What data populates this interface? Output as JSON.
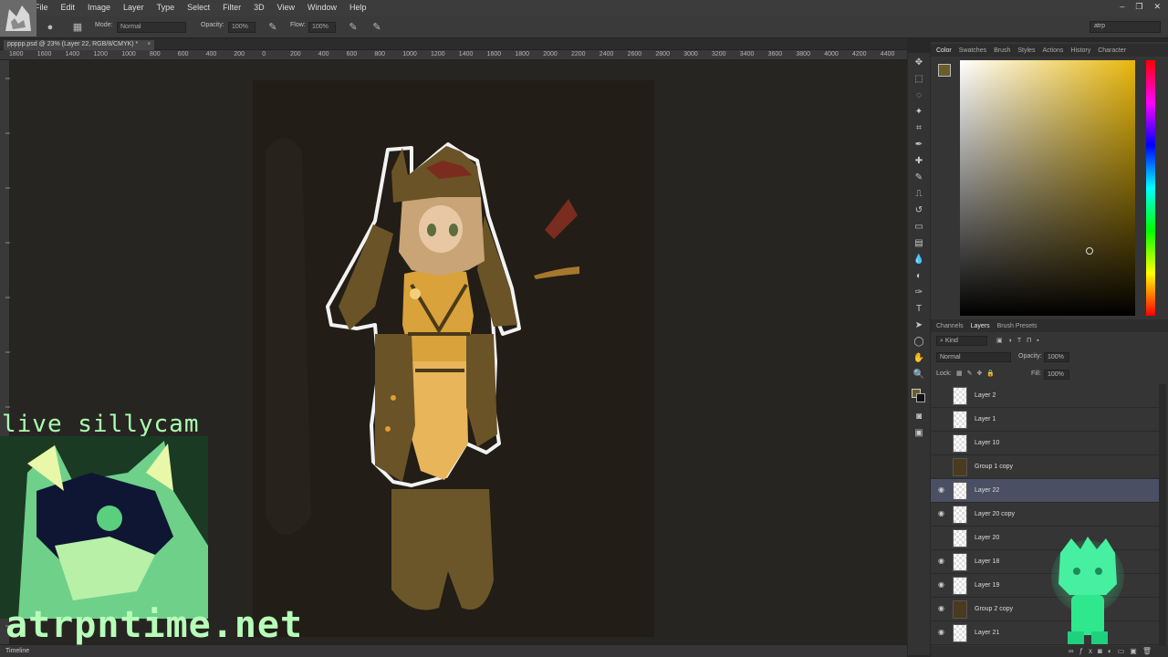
{
  "menubar": {
    "items": [
      "File",
      "Edit",
      "Image",
      "Layer",
      "Type",
      "Select",
      "Filter",
      "3D",
      "View",
      "Window",
      "Help"
    ],
    "window_controls": [
      "–",
      "❐",
      "✕"
    ]
  },
  "options": {
    "mode_label": "Mode:",
    "mode_value": "Normal",
    "opacity_label": "Opacity:",
    "opacity_value": "100%",
    "flow_label": "Flow:",
    "flow_value": "100%",
    "workspace": "atrp"
  },
  "document": {
    "tab_label": "ppppp.psd @ 23% (Layer 22, RGB/8/CMYK) *",
    "close": "×"
  },
  "ruler": {
    "ticks": [
      "1800",
      "1600",
      "1400",
      "1200",
      "1000",
      "800",
      "600",
      "400",
      "200",
      "0",
      "200",
      "400",
      "600",
      "800",
      "1000",
      "1200",
      "1400",
      "1600",
      "1800",
      "2000",
      "2200",
      "2400",
      "2600",
      "2800",
      "3000",
      "3200",
      "3400",
      "3600",
      "3800",
      "4000",
      "4200",
      "4400"
    ]
  },
  "status": {
    "timeline": "Timeline"
  },
  "color_panel": {
    "tabs": [
      "Color",
      "Swatches",
      "Brush",
      "Styles",
      "Actions",
      "History",
      "Character"
    ],
    "active_tab": "Color",
    "foreground": "#6b5c2b",
    "hue": "#e8b70c"
  },
  "layers_panel": {
    "tabs": [
      "Channels",
      "Layers",
      "Brush Presets"
    ],
    "active_tab": "Layers",
    "filter_kind": "Kind",
    "blend_mode": "Normal",
    "opacity_label": "Opacity:",
    "opacity_value": "100%",
    "lock_label": "Lock:",
    "fill_label": "Fill:",
    "fill_value": "100%",
    "layers": [
      {
        "name": "Layer 2",
        "visible": false,
        "selected": false,
        "group": false
      },
      {
        "name": "Layer 1",
        "visible": false,
        "selected": false,
        "group": false
      },
      {
        "name": "Layer 10",
        "visible": false,
        "selected": false,
        "group": false
      },
      {
        "name": "Group 1 copy",
        "visible": false,
        "selected": false,
        "group": true
      },
      {
        "name": "Layer 22",
        "visible": true,
        "selected": true,
        "group": false
      },
      {
        "name": "Layer 20 copy",
        "visible": true,
        "selected": false,
        "group": false
      },
      {
        "name": "Layer 20",
        "visible": false,
        "selected": false,
        "group": false
      },
      {
        "name": "Layer 18",
        "visible": true,
        "selected": false,
        "group": false
      },
      {
        "name": "Layer 19",
        "visible": true,
        "selected": false,
        "group": false
      },
      {
        "name": "Group 2 copy",
        "visible": true,
        "selected": false,
        "group": true
      },
      {
        "name": "Layer 21",
        "visible": true,
        "selected": false,
        "group": false
      }
    ]
  },
  "overlay": {
    "stream_label": "live_sillycam",
    "site_label": "atrpntime.net"
  }
}
